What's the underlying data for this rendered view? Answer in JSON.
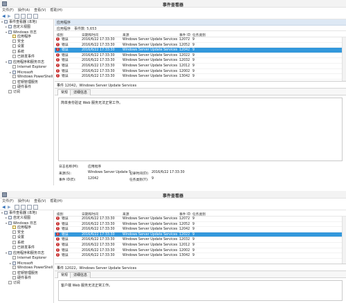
{
  "windows": [
    {
      "title": "事件查看器",
      "menu": [
        "文件(F)",
        "操作(A)",
        "查看(V)",
        "帮助(H)"
      ],
      "tree": [
        {
          "label": "事件查看器 (本地)",
          "indent": 0,
          "exp": "▾",
          "kind": "root"
        },
        {
          "label": "自定义视图",
          "indent": 1,
          "exp": "▸",
          "kind": "folder"
        },
        {
          "label": "Windows 日志",
          "indent": 1,
          "exp": "▾",
          "kind": "folder"
        },
        {
          "label": "应用程序",
          "indent": 2,
          "exp": "",
          "kind": "sel"
        },
        {
          "label": "安全",
          "indent": 2,
          "exp": "",
          "kind": "log"
        },
        {
          "label": "设置",
          "indent": 2,
          "exp": "",
          "kind": "log"
        },
        {
          "label": "系统",
          "indent": 2,
          "exp": "",
          "kind": "log"
        },
        {
          "label": "已转发事件",
          "indent": 2,
          "exp": "",
          "kind": "log"
        },
        {
          "label": "应用程序和服务日志",
          "indent": 1,
          "exp": "▾",
          "kind": "folder"
        },
        {
          "label": "Internet Explorer",
          "indent": 2,
          "exp": "",
          "kind": "log"
        },
        {
          "label": "Microsoft",
          "indent": 2,
          "exp": "▸",
          "kind": "folder"
        },
        {
          "label": "Windows PowerShell",
          "indent": 2,
          "exp": "",
          "kind": "log"
        },
        {
          "label": "密钥管理服务",
          "indent": 2,
          "exp": "",
          "kind": "log"
        },
        {
          "label": "硬件事件",
          "indent": 2,
          "exp": "",
          "kind": "log"
        },
        {
          "label": "订阅",
          "indent": 1,
          "exp": "",
          "kind": "log"
        }
      ],
      "pane_title": "应用程序",
      "count_label": "事件数: 5,653",
      "columns": {
        "level": "级别",
        "datetime": "日期和时间",
        "source": "来源",
        "event_id": "事件 ID",
        "category": "任务类别"
      },
      "rows": [
        {
          "level": "错误",
          "datetime": "2016/6/22 17:33:30",
          "source": "Windows Server Update Services",
          "event_id": "12072",
          "category": "9",
          "selected": false
        },
        {
          "level": "错误",
          "datetime": "2016/6/22 17:33:30",
          "source": "Windows Server Update Services",
          "event_id": "12052",
          "category": "9",
          "selected": false
        },
        {
          "level": "错误",
          "datetime": "2016/6/22 17:33:30",
          "source": "Windows Server Update Services",
          "event_id": "12042",
          "category": "9",
          "selected": true
        },
        {
          "level": "错误",
          "datetime": "2016/6/22 17:33:30",
          "source": "Windows Server Update Services",
          "event_id": "12022",
          "category": "9",
          "selected": false
        },
        {
          "level": "错误",
          "datetime": "2016/6/22 17:33:30",
          "source": "Windows Server Update Services",
          "event_id": "12032",
          "category": "9",
          "selected": false
        },
        {
          "level": "错误",
          "datetime": "2016/6/22 17:33:30",
          "source": "Windows Server Update Services",
          "event_id": "12012",
          "category": "9",
          "selected": false
        },
        {
          "level": "错误",
          "datetime": "2016/6/22 17:33:30",
          "source": "Windows Server Update Services",
          "event_id": "12002",
          "category": "9",
          "selected": false
        },
        {
          "level": "错误",
          "datetime": "2016/6/22 17:33:30",
          "source": "Windows Server Update Services",
          "event_id": "13042",
          "category": "9",
          "selected": false
        }
      ],
      "detail_title": "事件 12042，Windows Server Update Services",
      "tabs": [
        "常规",
        "详细信息"
      ],
      "message": "简单身份验证 Web 服务无法正常工作。",
      "props": {
        "logname_label": "日志名称(M):",
        "logname_value": "应用程序",
        "source_label": "来源(S):",
        "source_value": "Windows Server Update S",
        "logged_label": "记录时间(D):",
        "logged_value": "2016/6/22 17:33:30",
        "eventid_label": "事件 ID(E):",
        "eventid_value": "12042",
        "taskcat_label": "任务类别(Y):",
        "taskcat_value": "9"
      }
    },
    {
      "title": "事件查看器",
      "menu": [
        "文件(F)",
        "操作(A)",
        "查看(V)",
        "帮助(H)"
      ],
      "tree": [
        {
          "label": "事件查看器 (本地)",
          "indent": 0,
          "exp": "▾",
          "kind": "root"
        },
        {
          "label": "自定义视图",
          "indent": 1,
          "exp": "▸",
          "kind": "folder"
        },
        {
          "label": "Windows 日志",
          "indent": 1,
          "exp": "▾",
          "kind": "folder"
        },
        {
          "label": "应用程序",
          "indent": 2,
          "exp": "",
          "kind": "sel"
        },
        {
          "label": "安全",
          "indent": 2,
          "exp": "",
          "kind": "log"
        },
        {
          "label": "设置",
          "indent": 2,
          "exp": "",
          "kind": "log"
        },
        {
          "label": "系统",
          "indent": 2,
          "exp": "",
          "kind": "log"
        },
        {
          "label": "已转发事件",
          "indent": 2,
          "exp": "",
          "kind": "log"
        },
        {
          "label": "应用程序和服务日志",
          "indent": 1,
          "exp": "▾",
          "kind": "folder"
        },
        {
          "label": "Internet Explorer",
          "indent": 2,
          "exp": "",
          "kind": "log"
        },
        {
          "label": "Microsoft",
          "indent": 2,
          "exp": "▸",
          "kind": "folder"
        },
        {
          "label": "Windows PowerShell",
          "indent": 2,
          "exp": "",
          "kind": "log"
        },
        {
          "label": "密钥管理服务",
          "indent": 2,
          "exp": "",
          "kind": "log"
        },
        {
          "label": "硬件事件",
          "indent": 2,
          "exp": "",
          "kind": "log"
        },
        {
          "label": "订阅",
          "indent": 1,
          "exp": "",
          "kind": "log"
        }
      ],
      "pane_title": "应用程序",
      "count_label": "事件数: 5,653",
      "columns": {
        "level": "级别",
        "datetime": "日期和时间",
        "source": "来源",
        "event_id": "事件 ID",
        "category": "任务类别"
      },
      "rows": [
        {
          "level": "错误",
          "datetime": "2016/6/22 17:33:30",
          "source": "Windows Server Update Services",
          "event_id": "12072",
          "category": "9",
          "selected": false
        },
        {
          "level": "错误",
          "datetime": "2016/6/22 17:33:30",
          "source": "Windows Server Update Services",
          "event_id": "12052",
          "category": "9",
          "selected": false
        },
        {
          "level": "错误",
          "datetime": "2016/6/22 17:33:30",
          "source": "Windows Server Update Services",
          "event_id": "12042",
          "category": "9",
          "selected": false
        },
        {
          "level": "错误",
          "datetime": "2016/6/22 17:33:30",
          "source": "Windows Server Update Services",
          "event_id": "12022",
          "category": "9",
          "selected": true
        },
        {
          "level": "错误",
          "datetime": "2016/6/22 17:33:30",
          "source": "Windows Server Update Services",
          "event_id": "12032",
          "category": "9",
          "selected": false
        },
        {
          "level": "错误",
          "datetime": "2016/6/22 17:33:30",
          "source": "Windows Server Update Services",
          "event_id": "12012",
          "category": "9",
          "selected": false
        },
        {
          "level": "错误",
          "datetime": "2016/6/22 17:33:30",
          "source": "Windows Server Update Services",
          "event_id": "12002",
          "category": "9",
          "selected": false
        },
        {
          "level": "错误",
          "datetime": "2016/6/22 17:33:30",
          "source": "Windows Server Update Services",
          "event_id": "13042",
          "category": "9",
          "selected": false
        }
      ],
      "detail_title": "事件 12022，Windows Server Update Services",
      "tabs": [
        "常规",
        "详细信息"
      ],
      "message": "客户端 Web 服务无法正常工作。"
    }
  ]
}
